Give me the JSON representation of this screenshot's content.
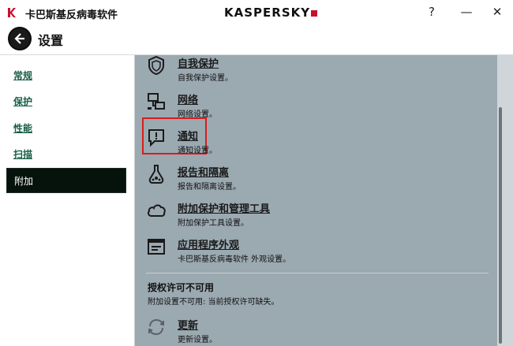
{
  "window": {
    "app_title": "卡巴斯基反病毒软件",
    "brand": "KASPERSKY",
    "help_label": "?",
    "minimize_label": "—",
    "close_label": "✕"
  },
  "header": {
    "title": "设置"
  },
  "sidebar": {
    "items": [
      {
        "label": "常规",
        "active": false
      },
      {
        "label": "保护",
        "active": false
      },
      {
        "label": "性能",
        "active": false
      },
      {
        "label": "扫描",
        "active": false
      },
      {
        "label": "附加",
        "active": true
      }
    ]
  },
  "settings": [
    {
      "icon": "shield-icon",
      "title": "自我保护",
      "description": "自我保护设置。"
    },
    {
      "icon": "network-icon",
      "title": "网络",
      "description": "网络设置。"
    },
    {
      "icon": "notification-icon",
      "title": "通知",
      "description": "通知设置。",
      "highlighted": true
    },
    {
      "icon": "quarantine-icon",
      "title": "报告和隔离",
      "description": "报告和隔离设置。"
    },
    {
      "icon": "cloud-icon",
      "title": "附加保护和管理工具",
      "description": "附加保护工具设置。"
    },
    {
      "icon": "app-window-icon",
      "title": "应用程序外观",
      "description": "卡巴斯基反病毒软件 外观设置。"
    }
  ],
  "license": {
    "title": "授权许可不可用",
    "description": "附加设置不可用: 当前授权许可缺失。"
  },
  "update": {
    "icon": "refresh-icon",
    "title": "更新",
    "description": "更新设置。"
  },
  "colors": {
    "active_nav": "#06130d",
    "link": "#175f45",
    "panel_bg": "#9ba9b1",
    "highlight": "#d71d1d",
    "brand_red": "#c8102e"
  }
}
